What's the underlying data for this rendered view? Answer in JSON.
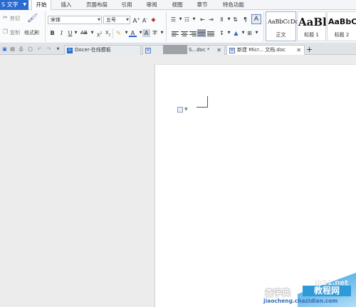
{
  "menubar": {
    "app_name": "S 文字",
    "tabs": [
      "开始",
      "插入",
      "页面布局",
      "引用",
      "审阅",
      "视图",
      "章节",
      "特色功能"
    ],
    "active_tab": "开始"
  },
  "ribbon": {
    "clipboard": {
      "cut": "剪切",
      "copy": "复制",
      "format_painter": "格式刷"
    },
    "font": {
      "family": "宋体",
      "size": "五号"
    },
    "styles": [
      {
        "sample": "AaBbCcDd",
        "name": "正文"
      },
      {
        "sample": "AaBl",
        "name": "标题 1"
      },
      {
        "sample": "AaBbC",
        "name": "标题 2"
      }
    ]
  },
  "tabbar": {
    "tabs": [
      {
        "label": "Docer-在线模板",
        "closable": false
      },
      {
        "label": "S...doc *",
        "closable": true
      },
      {
        "label": "新建 Micr... 文档.doc",
        "closable": true
      }
    ],
    "active_index": 2
  },
  "watermark": {
    "site": "jb51.net",
    "cn_left": "查字典",
    "cn_right": "教程网",
    "domain": "jiaocheng.chazidian.com"
  }
}
